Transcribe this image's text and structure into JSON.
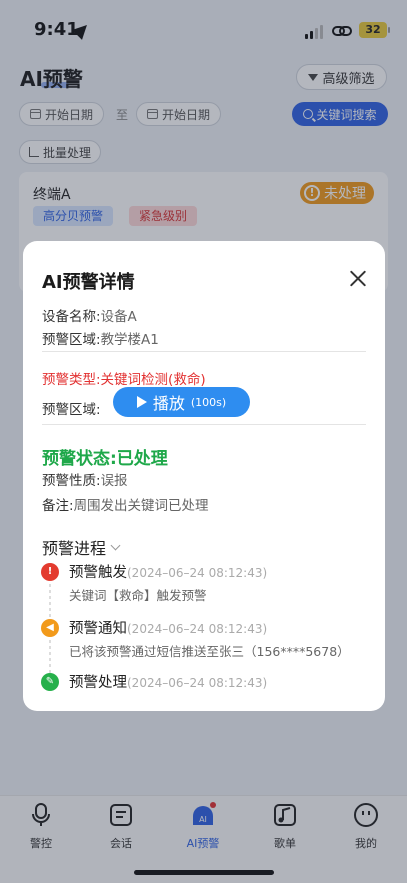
{
  "status_bar": {
    "time": "9:41",
    "battery": "32"
  },
  "header": {
    "title": "AI预警",
    "adv_filter_label": "高级筛选"
  },
  "filters": {
    "start_date_label": "开始日期",
    "separator": "至",
    "end_date_label": "开始日期",
    "keyword_search_label": "关键词搜索",
    "batch_label": "批量处理"
  },
  "card": {
    "title": "终端A",
    "status": "未处理",
    "tags": [
      "高分贝预警",
      "紧急级别"
    ]
  },
  "modal": {
    "title": "AI预警详情",
    "device_label": "设备名称:",
    "device_value": "设备A",
    "area_label": "预警区域:",
    "area_value": "教学楼A1",
    "type_line": "预警类型:关键词检测(救命)",
    "area2_label": "预警区域:",
    "play_label": "播放",
    "play_duration": "(100s)",
    "status_line": "预警状态:已处理",
    "nature_label": "预警性质:",
    "nature_value": "误报",
    "note_label": "备注:",
    "note_value": "周围发出关键词已处理",
    "progress_title": "预警进程",
    "steps": [
      {
        "title": "预警触发",
        "time": "(2024–06–24 08:12:43)",
        "desc": "关键词【救命】触发预警"
      },
      {
        "title": "预警通知",
        "time": "(2024–06–24 08:12:43)",
        "desc": "已将该预警通过短信推送至张三（156****5678）"
      },
      {
        "title": "预警处理",
        "time": "(2024–06–24 08:12:43)",
        "desc": ""
      }
    ]
  },
  "tabbar": {
    "items": [
      "警控",
      "会话",
      "AI预警",
      "歌单",
      "我的"
    ],
    "active": "AI预警"
  },
  "colors": {
    "primary": "#2f62e3",
    "play": "#2e8df0",
    "warning": "#f29a1b",
    "danger": "#e23030",
    "success": "#1fa84a"
  }
}
